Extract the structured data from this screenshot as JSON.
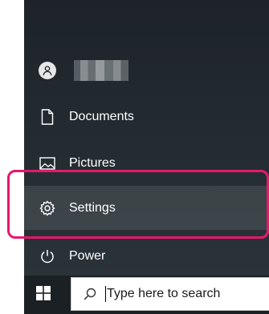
{
  "start_menu": {
    "user": {
      "avatar_icon": "person-icon"
    },
    "items": [
      {
        "id": "documents",
        "label": "Documents",
        "icon": "document-icon"
      },
      {
        "id": "pictures",
        "label": "Pictures",
        "icon": "picture-icon"
      },
      {
        "id": "settings",
        "label": "Settings",
        "icon": "gear-icon"
      },
      {
        "id": "power",
        "label": "Power",
        "icon": "power-icon"
      }
    ],
    "highlight_color": "#e8176b"
  },
  "taskbar": {
    "start_icon": "windows-logo-icon",
    "search": {
      "icon": "search-icon",
      "placeholder": "Type here to search"
    }
  }
}
